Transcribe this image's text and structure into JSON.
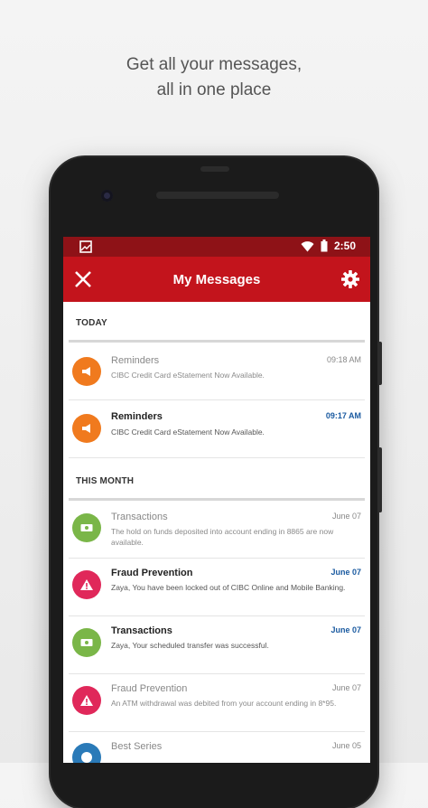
{
  "promo": {
    "line1": "Get all your messages,",
    "line2": "all in one place"
  },
  "status_bar": {
    "time": "2:50",
    "icons": [
      "image-icon",
      "wifi-icon",
      "battery-icon"
    ]
  },
  "app_bar": {
    "title": "My Messages",
    "left_icon": "close-icon",
    "right_icon": "gear-icon"
  },
  "sections": {
    "today": {
      "label": "TODAY",
      "messages": [
        {
          "category": "Reminders",
          "time": "09:18 AM",
          "body": "CIBC Credit Card eStatement Now Available.",
          "icon": "megaphone-icon",
          "color": "#f07a1e",
          "unread": false
        },
        {
          "category": "Reminders",
          "time": "09:17 AM",
          "body": "CIBC Credit Card eStatement Now Available.",
          "icon": "megaphone-icon",
          "color": "#f07a1e",
          "unread": true
        }
      ]
    },
    "this_month": {
      "label": "THIS MONTH",
      "messages": [
        {
          "category": "Transactions",
          "time": "June 07",
          "body": "The hold on funds deposited into account ending in 8865 are now available.",
          "icon": "money-icon",
          "color": "#7ab648",
          "unread": false
        },
        {
          "category": "Fraud Prevention",
          "time": "June 07",
          "body": "Zaya, You have been locked out of CIBC Online and Mobile Banking.",
          "icon": "warning-icon",
          "color": "#e0285a",
          "unread": true
        },
        {
          "category": "Transactions",
          "time": "June 07",
          "body": "Zaya, Your scheduled transfer was successful.",
          "icon": "money-icon",
          "color": "#7ab648",
          "unread": true
        },
        {
          "category": "Fraud Prevention",
          "time": "June 07",
          "body": "An ATM withdrawal was debited from your account ending in 8*95.",
          "icon": "warning-icon",
          "color": "#e0285a",
          "unread": false
        },
        {
          "category": "Best Series",
          "time": "June 05",
          "body": "",
          "icon": "info-icon",
          "color": "#2a7ab8",
          "unread": false
        }
      ]
    }
  }
}
